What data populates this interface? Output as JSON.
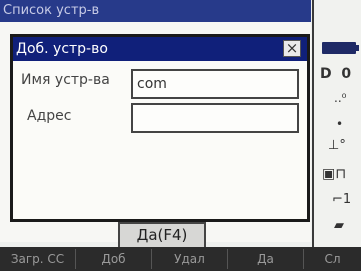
{
  "background_window": {
    "title": "Список устр-в"
  },
  "dialog": {
    "title": "Доб. устр-во",
    "close_glyph": "×",
    "fields": [
      {
        "label": "Имя устр-ва",
        "value": "com"
      },
      {
        "label": "Адрес",
        "value": ""
      }
    ],
    "ok_label": "Да(F4)"
  },
  "function_keys": [
    "Загр. СС",
    "Доб",
    "Удал",
    "Да",
    "Сл"
  ],
  "status_icons": [
    "battery-icon",
    "memory-icon",
    "signal-icon",
    "dot-icon",
    "prism-icon",
    "tilt-icon",
    "keyboard-icon"
  ],
  "colors": {
    "title_bar": "#10207a",
    "function_bar": "#2b2b2b",
    "battery": "#1f2a66"
  }
}
